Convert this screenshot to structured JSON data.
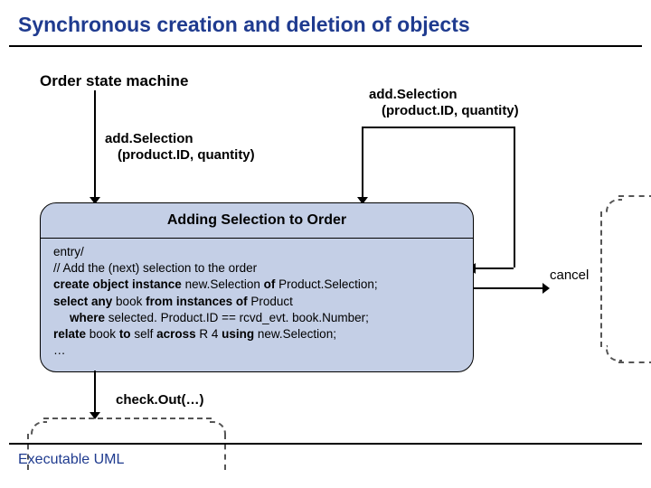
{
  "title": "Synchronous creation and deletion of objects",
  "subtitle": "Order state machine",
  "event_left": {
    "name": "add.Selection",
    "args": "(product.ID, quantity)"
  },
  "event_right": {
    "name": "add.Selection",
    "args": "(product.ID, quantity)"
  },
  "state": {
    "name": "Adding Selection to Order",
    "entry_kw": "entry/",
    "comment": "// Add the (next) selection to the order",
    "line1a": "create object instance",
    "line1b": " new.Selection ",
    "line1c": "of",
    "line1d": " Product.Selection;",
    "line2a": "select any",
    "line2b": " book ",
    "line2c": "from instances of",
    "line2d": " Product",
    "line3a": "where",
    "line3b": " selected. Product.ID == rcvd_evt. book.Number;",
    "line4a": "relate",
    "line4b": " book ",
    "line4c": "to",
    "line4d": " self ",
    "line4e": "across",
    "line4f": " R 4 ",
    "line4g": "using",
    "line4h": " new.Selection;",
    "ellipsis": "…"
  },
  "cancel_label": "cancel",
  "checkout_label": "check.Out(…)",
  "footer": "Executable UML"
}
